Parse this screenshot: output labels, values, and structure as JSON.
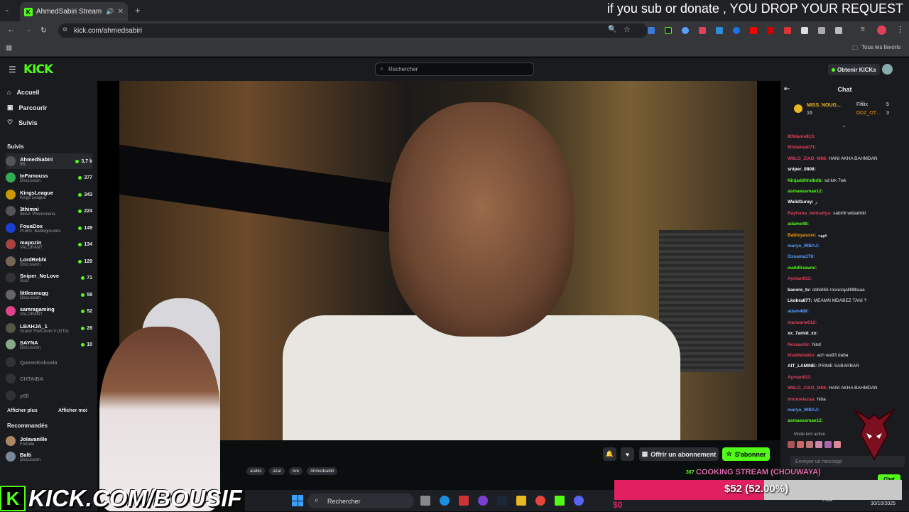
{
  "browser": {
    "tab_title": "AhmedSabiri Stream - Watc",
    "url": "kick.com/ahmedsabiri",
    "bookmarks_folder": "Tous les favoris"
  },
  "overlay": {
    "top_text": "if you sub or donate , YOU DROP YOUR REQUEST",
    "brand_text": "KICK.COM/BOUSIF",
    "goal_title": "COOKING STREAM (CHOUWAYA)",
    "goal_value": "$52 (52.00%)",
    "goal_progress": 0.52,
    "goal_current": "$0"
  },
  "kick": {
    "logo": "KICK",
    "search_placeholder": "Rechercher",
    "get_kicks": "Obtenir KICKs",
    "nav": [
      {
        "label": "Accueil",
        "icon": "home-icon"
      },
      {
        "label": "Parcourir",
        "icon": "browse-icon"
      },
      {
        "label": "Suivis",
        "icon": "heart-icon"
      }
    ],
    "followed_label": "Suivis",
    "channels": [
      {
        "name": "AhmedSabiri",
        "cat": "IRL",
        "viewers": "3,7 k"
      },
      {
        "name": "InFamouss",
        "cat": "Discussion",
        "viewers": "377"
      },
      {
        "name": "KingsLeague",
        "cat": "Kings League",
        "viewers": "343"
      },
      {
        "name": "3thimni",
        "cat": "Ibils3: Phenomena",
        "viewers": "224"
      },
      {
        "name": "FouaDox",
        "cat": "PUBG: Battlegrounds",
        "viewers": "149"
      },
      {
        "name": "mapozin",
        "cat": "VALORANT",
        "viewers": "134"
      },
      {
        "name": "LordRebhi",
        "cat": "Discussion",
        "viewers": "129"
      },
      {
        "name": "Sniper_NoLove",
        "cat": "Rust",
        "viewers": "71"
      },
      {
        "name": "littlesmugg",
        "cat": "Discussion",
        "viewers": "58"
      },
      {
        "name": "samragaming",
        "cat": "VALORANT",
        "viewers": "52"
      },
      {
        "name": "LBAHJA_1",
        "cat": "Grand Theft Auto V (GTA)",
        "viewers": "28"
      },
      {
        "name": "SAYNA",
        "cat": "Discussion",
        "viewers": "10"
      }
    ],
    "offline": [
      "QueenKokoala",
      "CHTAIBA",
      "y0ll"
    ],
    "show_more": "Afficher plus",
    "show_less": "Afficher moi",
    "recommended_label": "Recommandés",
    "recommended": [
      {
        "name": "Jolavanille",
        "cat": "Fortnite"
      },
      {
        "name": "Balti",
        "cat": "Discussion"
      }
    ],
    "buttons": {
      "gift_sub": "Offrir un abonnement",
      "subscribe": "S'abonner"
    },
    "tags": [
      "arabic",
      "azar",
      "live",
      "Ahmedsabiri"
    ]
  },
  "chat": {
    "title": "Chat",
    "pinned": {
      "user": "MISS_NOUG...",
      "count": "16",
      "top2": "Fifilix",
      "top3": "DDZ_OT...",
      "n2": "5",
      "n3": "3"
    },
    "messages": [
      {
        "u": "80blame813:",
        "t": "",
        "c": "#e0405a"
      },
      {
        "u": "Mistakaali71:",
        "t": "",
        "c": "#e0405a"
      },
      {
        "u": "W8LG_ZIAD_M88:",
        "t": "HANI AKHA BAHMDAN",
        "c": "#e0405a"
      },
      {
        "u": "sniper_0808:",
        "t": "",
        "c": "#ffffff"
      },
      {
        "u": "Ninjaddhhdbdb:",
        "t": "sd krk 7wk",
        "c": "#53fc18"
      },
      {
        "u": "asmaeasmae12:",
        "t": "",
        "c": "#53fc18"
      },
      {
        "u": "Walid1uray:",
        "t": "ر",
        "c": "#ffffff"
      },
      {
        "u": "Rayhana_lwidadiya:",
        "t": "sabirili widadiiiiii",
        "c": "#e0405a"
      },
      {
        "u": "adame48:",
        "t": "",
        "c": "#53fc18"
      },
      {
        "u": "Babloyassre:",
        "t": "هههه",
        "c": "#ff9900"
      },
      {
        "u": "maryo_WBAJ:",
        "t": "",
        "c": "#5aa0ff"
      },
      {
        "u": "Ossama176:",
        "t": "",
        "c": "#5aa0ff"
      },
      {
        "u": "walidfreawni:",
        "t": "",
        "c": "#53fc18"
      },
      {
        "u": "Ayman911:",
        "t": "",
        "c": "#e0405a"
      },
      {
        "u": "bacore_tv:",
        "t": "sbbirlilili rooooojalllllllllaaa",
        "c": "#ffffff"
      },
      {
        "u": "Lkobra877:",
        "t": "MEAMN MDABEZ TANI ?",
        "c": "#ffffff"
      },
      {
        "u": "adam488:",
        "t": "",
        "c": "#5aa0ff"
      },
      {
        "u": "marwane012:",
        "t": "",
        "c": "#e0405a"
      },
      {
        "u": "xx_7amid_xx:",
        "t": "",
        "c": "#ffffff"
      },
      {
        "u": "Noraachir:",
        "t": "hind",
        "c": "#e0405a"
      },
      {
        "u": "khaldebakis:",
        "t": "ach wa93 daba",
        "c": "#e0405a"
      },
      {
        "u": "AIT_LAMINE:",
        "t": "PRIME SABARBAR",
        "c": "#ffffff"
      },
      {
        "u": "Ayman911:",
        "t": "",
        "c": "#e0405a"
      },
      {
        "u": "W8LG_ZIAD_M88:",
        "t": "HANI AKHA BAHMDAN",
        "c": "#e0405a"
      },
      {
        "u": "imranelazaa:",
        "t": "hiba",
        "c": "#e0405a"
      },
      {
        "u": "maryo_WBAJ:",
        "t": "",
        "c": "#5aa0ff"
      },
      {
        "u": "asmaeasmae12:",
        "t": "",
        "c": "#53fc18"
      }
    ],
    "slow_mode": "Mode lent activé",
    "input_placeholder": "Envoyer un message",
    "send": "Chat"
  },
  "taskbar": {
    "search": "Rechercher",
    "date": "30/10/2025",
    "lang": "FRA",
    "viewers": "367"
  }
}
